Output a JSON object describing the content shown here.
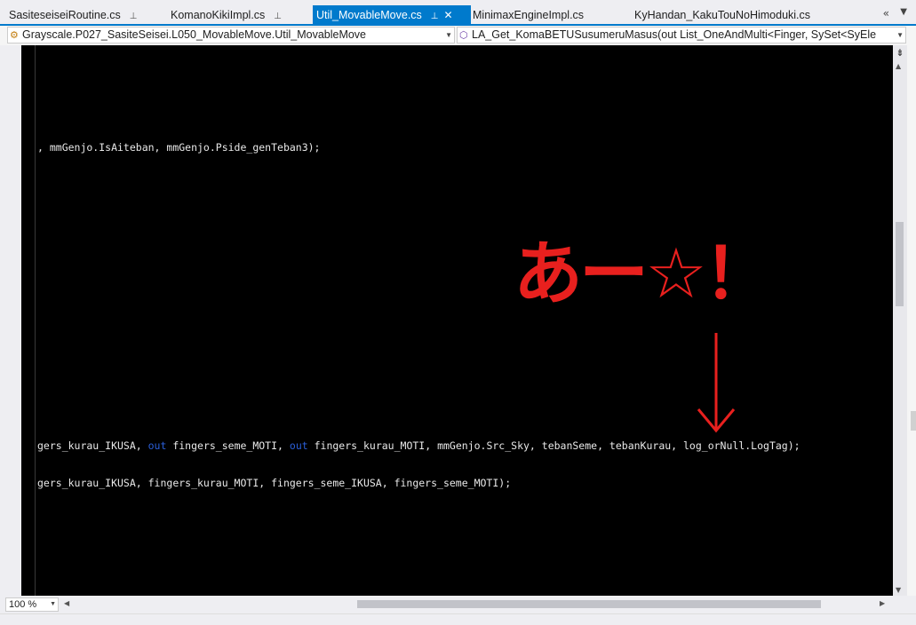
{
  "tabs": [
    {
      "label": "SasiteseiseiRoutine.cs",
      "pinned": true,
      "active": false
    },
    {
      "label": "KomanoKikiImpl.cs",
      "pinned": true,
      "active": false
    },
    {
      "label": "Util_MovableMove.cs",
      "pinned": true,
      "active": true
    },
    {
      "label": "MinimaxEngineImpl.cs",
      "pinned": false,
      "active": false
    },
    {
      "label": "KyHandan_KakuTouNoHimoduki.cs",
      "pinned": false,
      "active": false
    }
  ],
  "navbar": {
    "type_combo": "Grayscale.P027_SasiteSeisei.L050_MovableMove.Util_MovableMove",
    "member_combo": "LA_Get_KomaBETUSusumeruMasus(out List_OneAndMulti<Finger, SySet<SyEle"
  },
  "code": {
    "line1_text": ", mmGenjo.IsAiteban, mmGenjo.Pside_genTeban3);",
    "line2_a": "gers_kurau_IKUSA, ",
    "line2_kw1": "out",
    "line2_b": " fingers_seme_MOTI, ",
    "line2_kw2": "out",
    "line2_c": " fingers_kurau_MOTI, mmGenjo.Src_Sky, tebanSeme, tebanKurau, log_orNull.LogTag);",
    "line3_text": "gers_kurau_IKUSA, fingers_kurau_MOTI, fingers_seme_IKUSA, fingers_seme_MOTI);"
  },
  "annotation": {
    "text": "あー☆！",
    "color": "#e8201e"
  },
  "zoom": {
    "value": "100 %"
  },
  "colors": {
    "accent": "#007acc",
    "editor_bg": "#000000",
    "keyword": "#2b5fd9"
  }
}
